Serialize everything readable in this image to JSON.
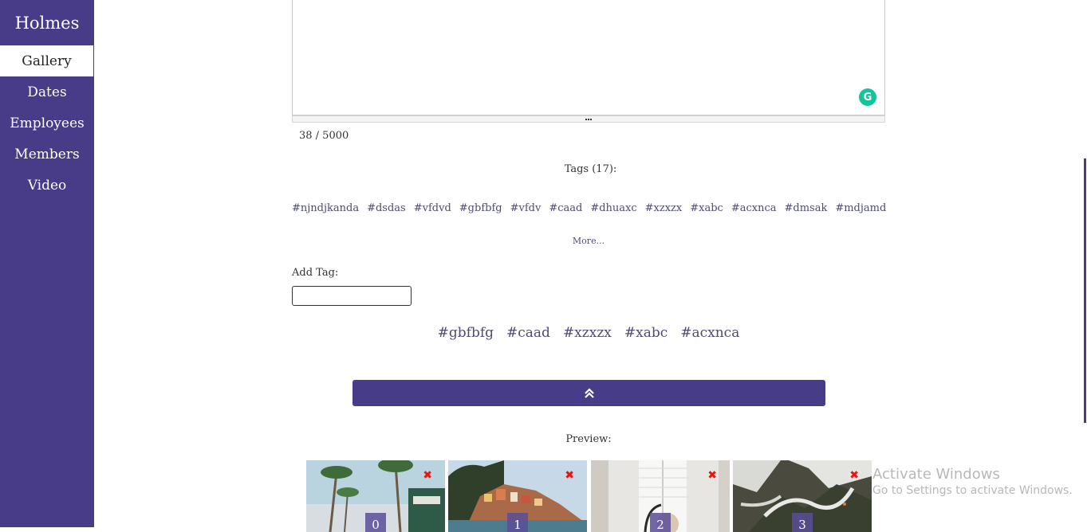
{
  "sidebar": {
    "brand": "Holmes",
    "items": [
      {
        "label": "Gallery",
        "active": true
      },
      {
        "label": "Dates"
      },
      {
        "label": "Employees"
      },
      {
        "label": "Members"
      },
      {
        "label": "Video"
      }
    ]
  },
  "editor": {
    "char_count": "38 / 5000",
    "grammarly_glyph": "G"
  },
  "tags": {
    "title": "Tags (17):",
    "list": [
      "#njndjkanda",
      "#dsdas",
      "#vfdvd",
      "#gbfbfg",
      "#vfdv",
      "#caad",
      "#dhuaxc",
      "#xzxzx",
      "#xabc",
      "#acxnca",
      "#dmsak",
      "#mdjamd"
    ],
    "more_label": "More..."
  },
  "add_tag": {
    "label": "Add Tag:",
    "value": "",
    "placeholder": ""
  },
  "selected_tags": [
    "#gbfbfg",
    "#caad",
    "#xzxzx",
    "#xabc",
    "#acxnca"
  ],
  "collapse_button": {
    "icon": "chevron-double-up-icon"
  },
  "preview": {
    "label": "Preview:",
    "images": [
      {
        "index": "0",
        "remove": "✖"
      },
      {
        "index": "1",
        "remove": "✖"
      },
      {
        "index": "2",
        "remove": "✖"
      },
      {
        "index": "3",
        "remove": "✖"
      }
    ]
  },
  "watermark": {
    "line1": "Activate Windows",
    "line2": "Go to Settings to activate Windows."
  },
  "colors": {
    "sidebar": "#483b87",
    "button": "#463c88",
    "tag_text": "#4e4c72",
    "remove": "#ee1111",
    "grammarly": "#15c39a"
  }
}
